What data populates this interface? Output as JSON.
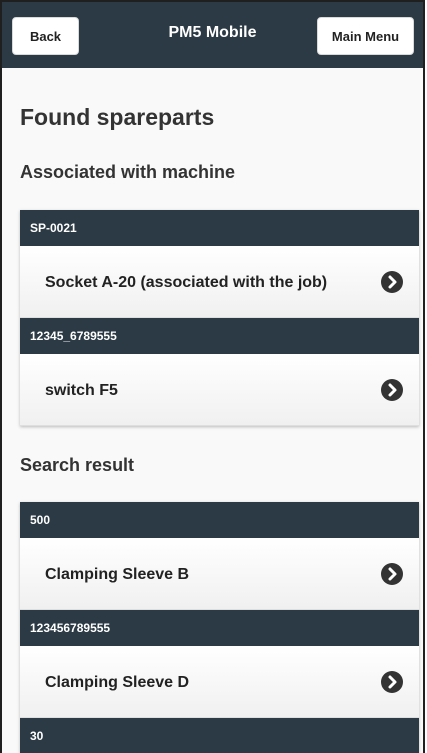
{
  "header": {
    "back_label": "Back",
    "title": "PM5 Mobile",
    "menu_label": "Main Menu"
  },
  "page_title": "Found spareparts",
  "associated": {
    "title": "Associated with machine",
    "items": [
      {
        "code": "SP-0021",
        "name": "Socket A-20 (associated with the job)"
      },
      {
        "code": "12345_6789555",
        "name": "switch F5"
      }
    ]
  },
  "search": {
    "title": "Search result",
    "items": [
      {
        "code": "500",
        "name": "Clamping Sleeve B"
      },
      {
        "code": "123456789555",
        "name": "Clamping Sleeve D"
      },
      {
        "code": "30",
        "name": ""
      }
    ]
  },
  "colors": {
    "header_bg": "#2b3a44",
    "divider_bg": "#2b3a44",
    "arrow_bg": "#333333"
  },
  "icons": {
    "item_arrow": "arrow-right-circle-icon"
  }
}
